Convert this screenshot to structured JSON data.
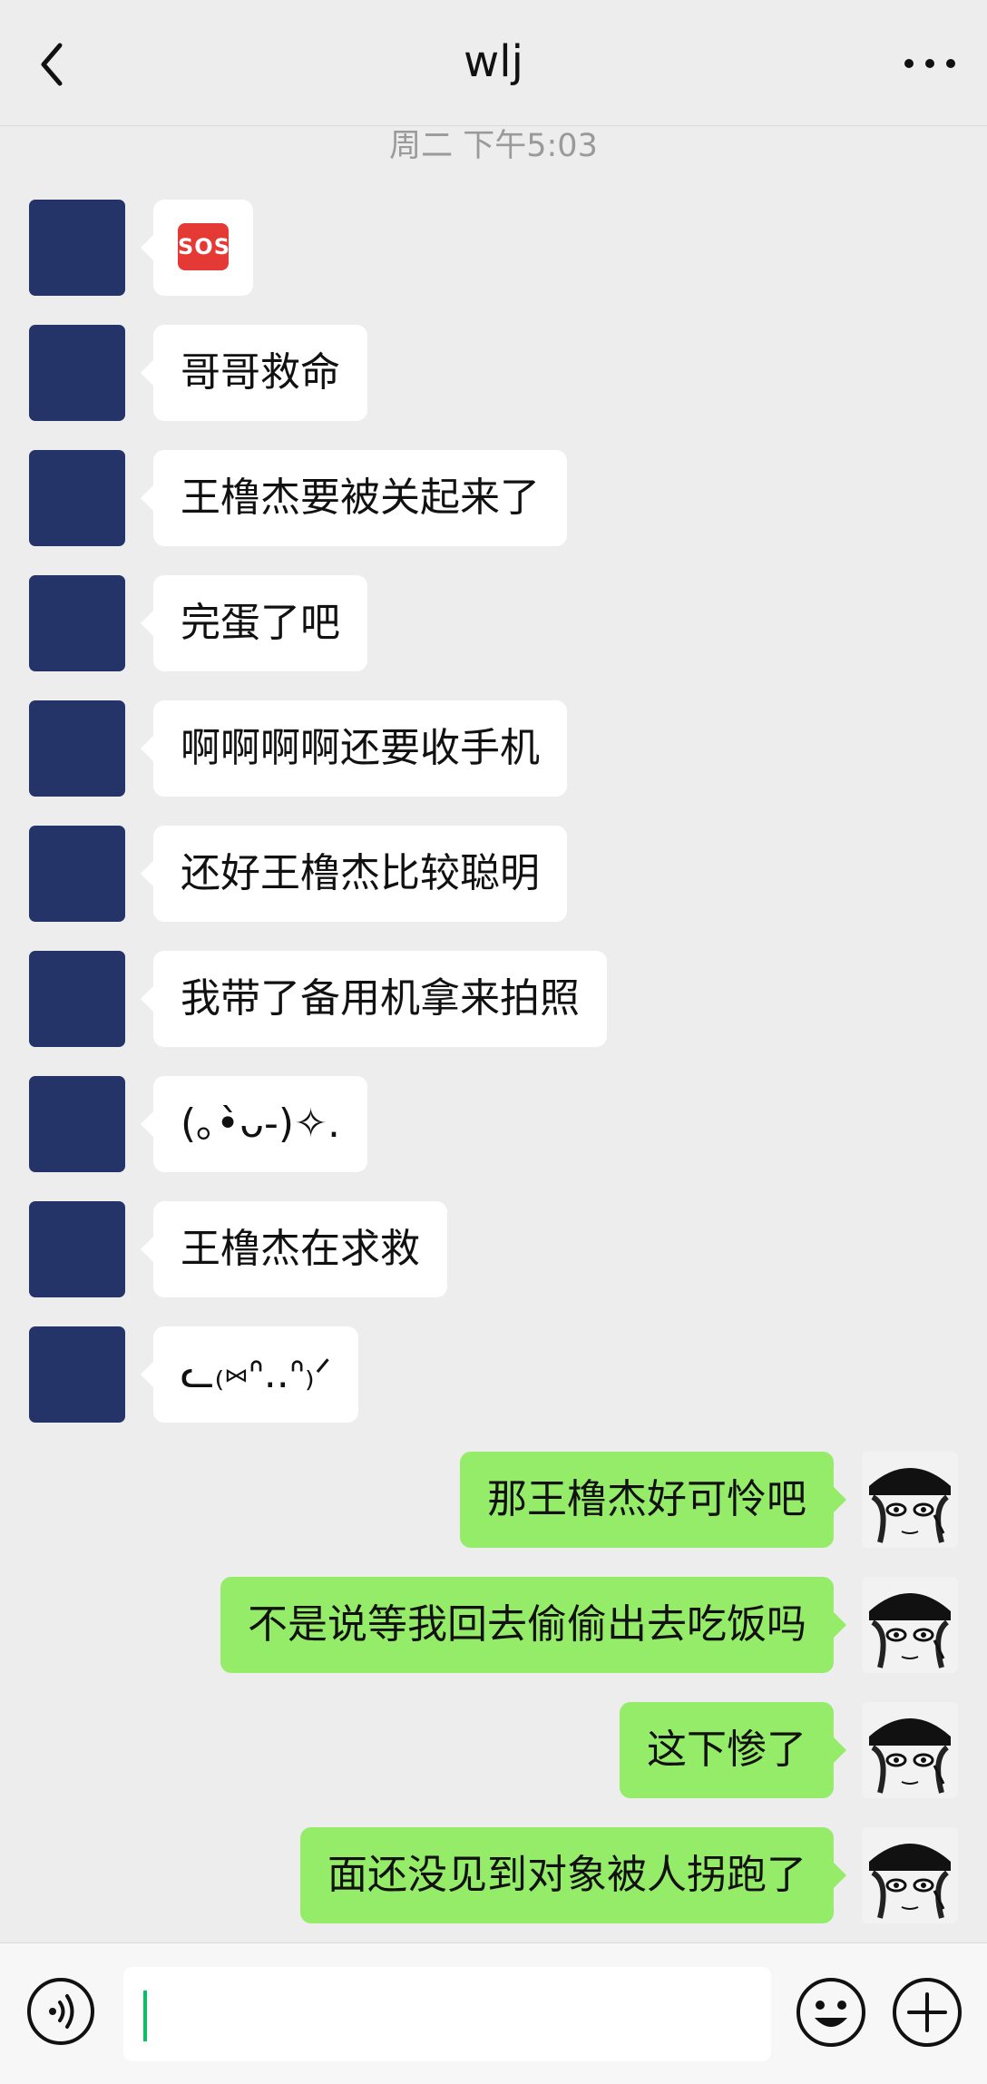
{
  "header": {
    "title": "wlj"
  },
  "timestamp": "周二 下午5:03",
  "messages_left": [
    {
      "text": "哥哥救命"
    },
    {
      "text": "王橹杰要被关起来了"
    },
    {
      "text": "完蛋了吧"
    },
    {
      "text": "啊啊啊啊还要收手机"
    },
    {
      "text": "还好王橹杰比较聪明"
    },
    {
      "text": "我带了备用机拿来拍照"
    },
    {
      "text": "(｡•̀ᴗ-)✧."
    },
    {
      "text": "王橹杰在求救"
    },
    {
      "text": "ᓚ₍⑅ᐢ..ᐢ₎ᐟ"
    }
  ],
  "sos_emoji": {
    "label": "SOS",
    "icon": "sos-emoji-icon"
  },
  "messages_right": [
    {
      "text": "那王橹杰好可怜吧"
    },
    {
      "text": "不是说等我回去偷偷出去吃饭吗"
    },
    {
      "text": "这下惨了"
    },
    {
      "text": "面还没见到对象被人拐跑了"
    }
  ],
  "input": {
    "value": ""
  },
  "colors": {
    "background": "#ededed",
    "self_bubble": "#95ec69",
    "other_bubble": "#ffffff",
    "other_avatar": "#243469",
    "cursor": "#07c160"
  },
  "icons": [
    "back-arrow-icon",
    "more-dots-icon",
    "voice-icon",
    "emoji-icon",
    "plus-icon"
  ]
}
